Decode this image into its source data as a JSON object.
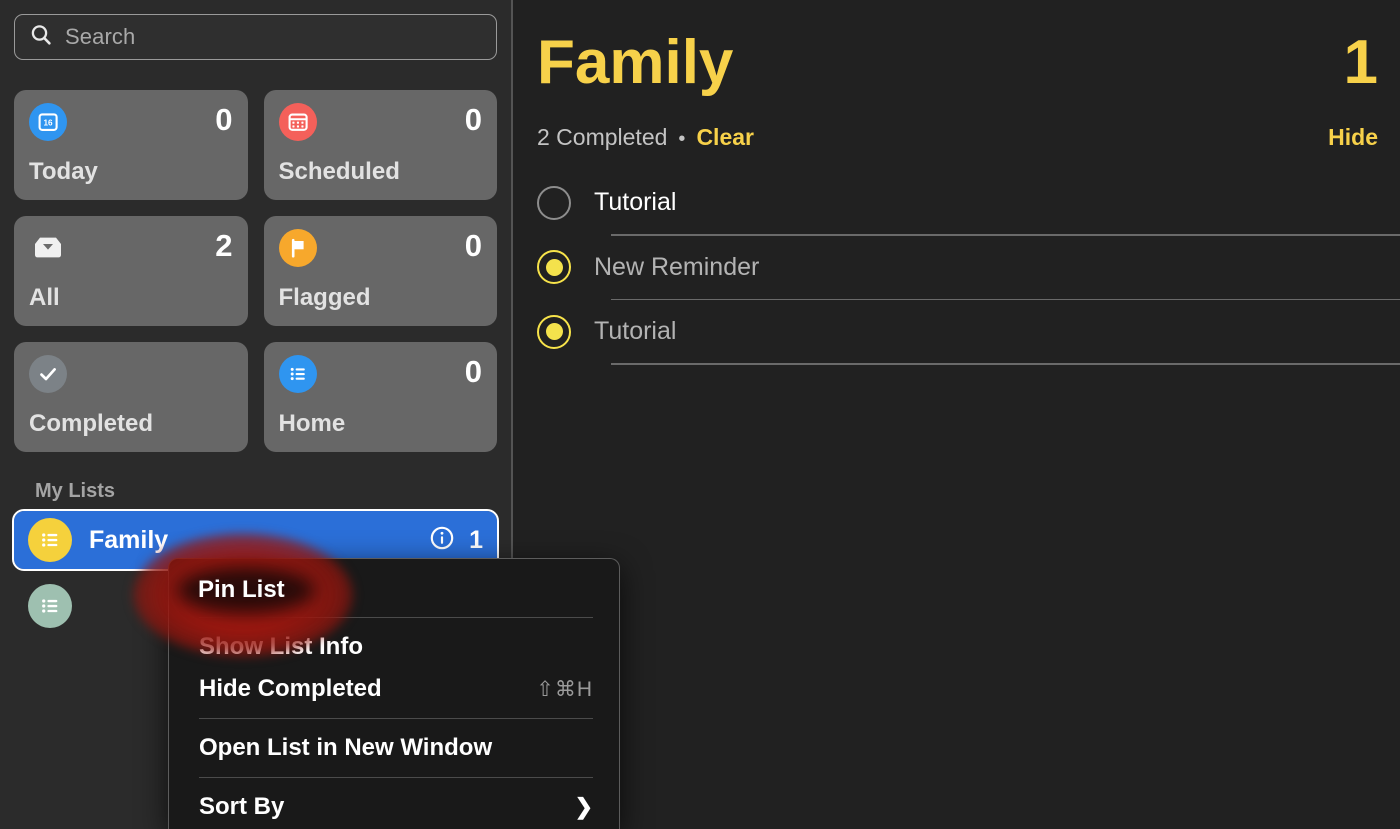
{
  "colors": {
    "accent_yellow": "#f7d14a",
    "selection_blue": "#2b6fd8",
    "sidebar_bg": "#2b2b2b",
    "content_bg": "#212121",
    "card_bg": "#676767",
    "annotation_red": "#aa160e"
  },
  "sidebar": {
    "search": {
      "placeholder": "Search",
      "value": ""
    },
    "cards": [
      {
        "id": "today",
        "label": "Today",
        "count": "0",
        "icon": "calendar-day-icon",
        "icon_color": "#2f95f0",
        "day": "16"
      },
      {
        "id": "scheduled",
        "label": "Scheduled",
        "count": "0",
        "icon": "calendar-icon",
        "icon_color": "#f4605a"
      },
      {
        "id": "all",
        "label": "All",
        "count": "2",
        "icon": "inbox-icon",
        "icon_color": "transparent"
      },
      {
        "id": "flagged",
        "label": "Flagged",
        "count": "0",
        "icon": "flag-icon",
        "icon_color": "#f7a82c"
      },
      {
        "id": "completed",
        "label": "Completed",
        "count": "",
        "icon": "checkmark-icon",
        "icon_color": "#7c8287"
      },
      {
        "id": "home",
        "label": "Home",
        "count": "0",
        "icon": "list-bullet-icon",
        "icon_color": "#2f95f0"
      }
    ],
    "my_lists": {
      "section_label": "My Lists",
      "items": [
        {
          "name": "Family",
          "count": "1",
          "icon": "list-bullet-icon",
          "icon_color": "#f5d13c",
          "selected": true,
          "info_icon": "info-circle-icon"
        },
        {
          "name": "",
          "count": "",
          "icon": "list-bullet-icon",
          "icon_color": "#9ec0b0",
          "selected": false
        }
      ]
    }
  },
  "main": {
    "title": "Family",
    "count": "1",
    "completed_text": "2 Completed",
    "separator": "•",
    "clear_label": "Clear",
    "hide_label": "Hide",
    "reminders": [
      {
        "text": "Tutorial",
        "completed": false
      },
      {
        "text": "New Reminder",
        "completed": true
      },
      {
        "text": "Tutorial",
        "completed": true
      }
    ]
  },
  "context_menu": {
    "items": [
      {
        "label": "Pin List",
        "shortcut": "",
        "submenu": false,
        "highlighted": true
      },
      {
        "label": "Show List Info",
        "shortcut": "",
        "submenu": false,
        "highlighted": false
      },
      {
        "label": "Hide Completed",
        "shortcut": "⇧⌘H",
        "submenu": false,
        "highlighted": false
      },
      {
        "label": "Open List in New Window",
        "shortcut": "",
        "submenu": false,
        "highlighted": false
      },
      {
        "label": "Sort By",
        "shortcut": "",
        "submenu": true,
        "highlighted": false
      }
    ],
    "submenu_arrow": "❯"
  },
  "annotation": {
    "target_label": "Pin List",
    "shape": "ellipse-highlight",
    "color": "#aa160e"
  }
}
